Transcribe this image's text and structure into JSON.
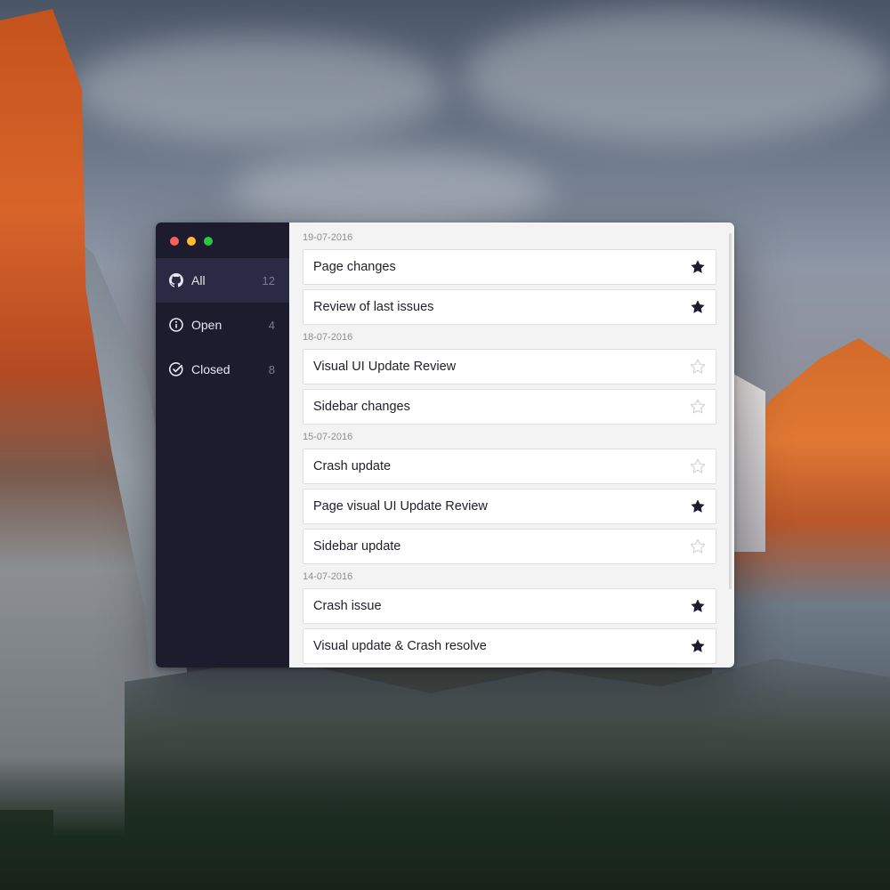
{
  "window": {
    "traffic_lights": [
      {
        "name": "close",
        "color": "#ff5f57"
      },
      {
        "name": "minimize",
        "color": "#febc2e"
      },
      {
        "name": "zoom",
        "color": "#28c840"
      }
    ]
  },
  "sidebar": {
    "items": [
      {
        "label": "All",
        "count": "12",
        "icon": "github-icon",
        "active": true
      },
      {
        "label": "Open",
        "count": "4",
        "icon": "info-circle-icon",
        "active": false
      },
      {
        "label": "Closed",
        "count": "8",
        "icon": "check-circle-icon",
        "active": false
      }
    ]
  },
  "main": {
    "groups": [
      {
        "date": "19-07-2016",
        "items": [
          {
            "title": "Page changes",
            "starred": true
          },
          {
            "title": "Review of last issues",
            "starred": true
          }
        ]
      },
      {
        "date": "18-07-2016",
        "items": [
          {
            "title": "Visual UI Update Review",
            "starred": false
          },
          {
            "title": "Sidebar changes",
            "starred": false
          }
        ]
      },
      {
        "date": "15-07-2016",
        "items": [
          {
            "title": "Crash update",
            "starred": false
          },
          {
            "title": "Page visual UI Update Review",
            "starred": true
          },
          {
            "title": "Sidebar update",
            "starred": false
          }
        ]
      },
      {
        "date": "14-07-2016",
        "items": [
          {
            "title": "Crash issue",
            "starred": true
          },
          {
            "title": "Visual update & Crash resolve",
            "starred": true
          }
        ]
      }
    ]
  },
  "colors": {
    "sidebar_bg": "#1d1c2e",
    "sidebar_active": "#2b2a45",
    "star_filled": "#1d1c2e",
    "star_empty": "#d0d0d4"
  }
}
